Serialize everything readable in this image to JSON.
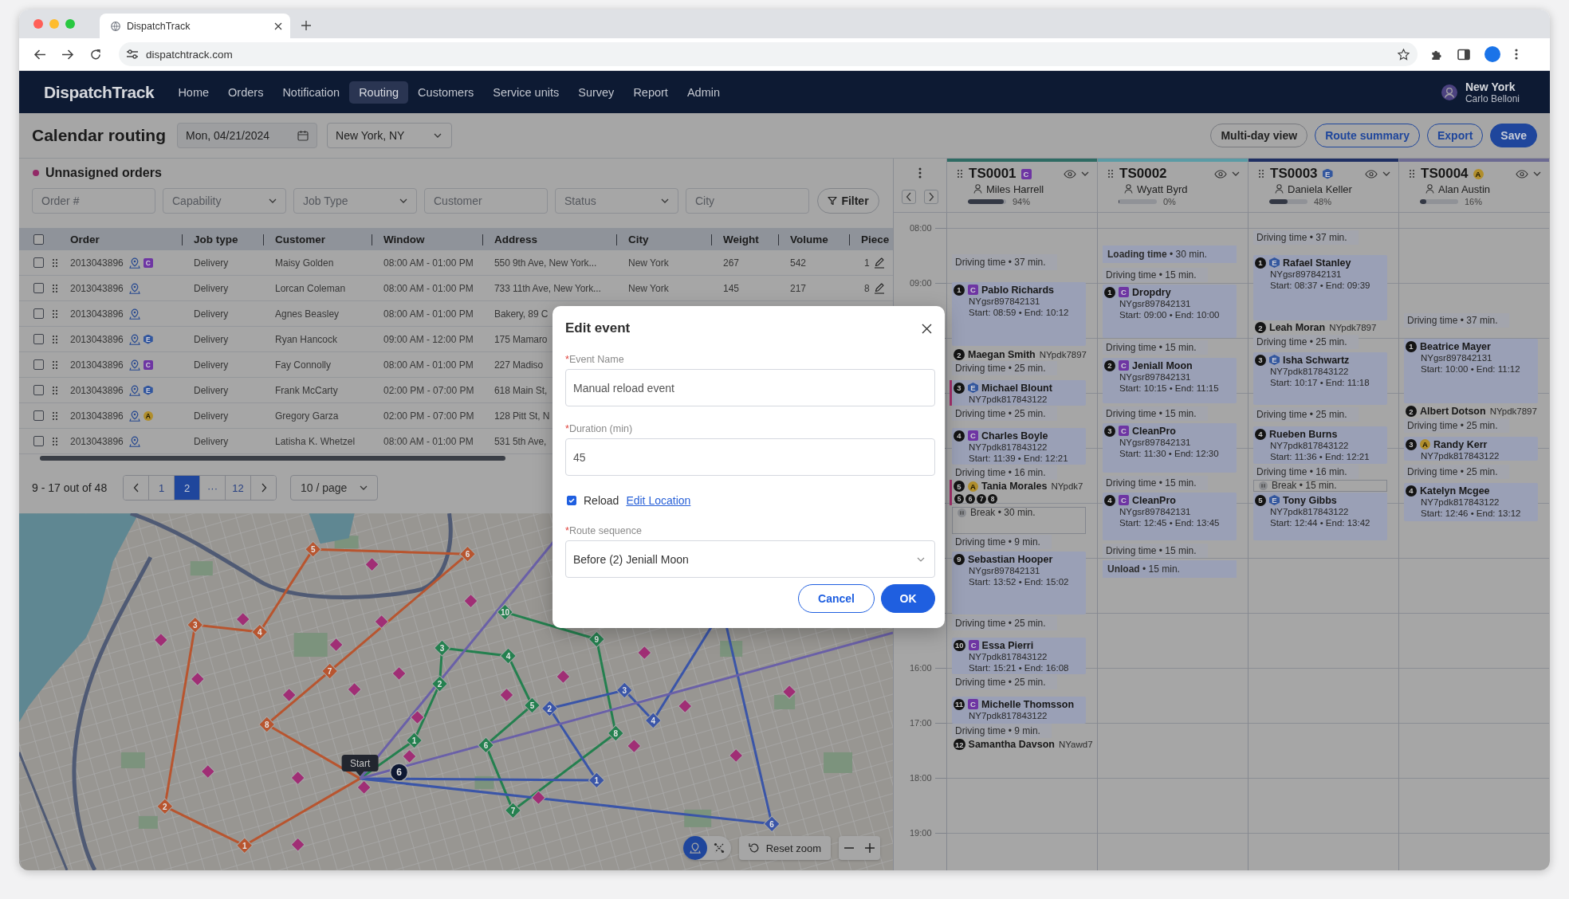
{
  "browser": {
    "tab_title": "DispatchTrack",
    "url": "dispatchtrack.com"
  },
  "nav": {
    "logo": "DispatchTrack",
    "items": [
      {
        "label": "Home",
        "selected": false
      },
      {
        "label": "Orders",
        "selected": false
      },
      {
        "label": "Notification",
        "selected": false
      },
      {
        "label": "Routing",
        "selected": true
      },
      {
        "label": "Customers",
        "selected": false
      },
      {
        "label": "Service units",
        "selected": false
      },
      {
        "label": "Survey",
        "selected": false
      },
      {
        "label": "Report",
        "selected": false
      },
      {
        "label": "Admin",
        "selected": false
      }
    ],
    "user": {
      "location": "New York",
      "name": "Carlo Belloni"
    }
  },
  "header": {
    "title": "Calendar routing",
    "date": "Mon, 04/21/2024",
    "city": "New York, NY",
    "buttons": [
      {
        "label": "Multi-day view",
        "kind": "default"
      },
      {
        "label": "Route summary",
        "kind": "outline"
      },
      {
        "label": "Export",
        "kind": "outline"
      },
      {
        "label": "Save",
        "kind": "primary"
      }
    ]
  },
  "orders": {
    "title": "Unnasigned orders",
    "filters": [
      {
        "kind": "input",
        "placeholder": "Order #"
      },
      {
        "kind": "select",
        "placeholder": "Capability"
      },
      {
        "kind": "select",
        "placeholder": "Job Type"
      },
      {
        "kind": "input",
        "placeholder": "Customer"
      },
      {
        "kind": "select",
        "placeholder": "Status"
      },
      {
        "kind": "input",
        "placeholder": "City"
      }
    ],
    "filter_button": "Filter",
    "select_all": {
      "checked": false
    },
    "columns": [
      "Order",
      "Job type",
      "Customer",
      "Window",
      "Address",
      "City",
      "Weight",
      "Volume",
      "Piece"
    ],
    "rows": [
      {
        "checked": false,
        "order": "2013043896",
        "badge": {
          "kind": "square",
          "text": "C",
          "color": "#6e35a3"
        },
        "job_type": "Delivery",
        "customer": "Maisy Golden",
        "window": "08:00 AM - 01:00 PM",
        "address": "550 9th Ave, New York...",
        "city": "New York",
        "weight": "267",
        "volume": "542",
        "pieces": "1"
      },
      {
        "checked": false,
        "order": "2013043896",
        "job_type": "Delivery",
        "customer": "Lorcan Coleman",
        "window": "08:00 AM - 01:00 PM",
        "address": "733 11th Ave, New York...",
        "city": "New York",
        "weight": "145",
        "volume": "217",
        "pieces": "8"
      },
      {
        "checked": false,
        "order": "2013043896",
        "job_type": "Delivery",
        "customer": "Agnes Beasley",
        "window": "08:00 AM - 01:00 PM",
        "address": "Bakery, 89 C"
      },
      {
        "checked": false,
        "order": "2013043896",
        "badge": {
          "kind": "hexagon",
          "text": "E",
          "color": "#33579e"
        },
        "job_type": "Delivery",
        "customer": "Ryan Hancock",
        "window": "09:00 AM - 12:00 PM",
        "address": "175 Mamaro"
      },
      {
        "checked": false,
        "order": "2013043896",
        "badge": {
          "kind": "square",
          "text": "C",
          "color": "#6e35a3"
        },
        "job_type": "Delivery",
        "customer": "Fay Connolly",
        "window": "08:00 AM - 01:00 PM",
        "address": "227 Madiso"
      },
      {
        "checked": false,
        "order": "2013043896",
        "badge": {
          "kind": "hexagon",
          "text": "E",
          "color": "#33579e"
        },
        "job_type": "Delivery",
        "customer": "Frank McCarty",
        "window": "02:00 PM - 07:00 PM",
        "address": "618 Main St,"
      },
      {
        "checked": false,
        "order": "2013043896",
        "badge": {
          "kind": "circle",
          "text": "A",
          "color": "#b08e2c"
        },
        "job_type": "Delivery",
        "customer": "Gregory Garza",
        "window": "02:00 PM - 07:00 PM",
        "address": "128 Pitt St, N"
      },
      {
        "checked": false,
        "order": "2013043896",
        "job_type": "Delivery",
        "customer": "Latisha K. Whetzel",
        "window": "08:00 AM - 01:00 PM",
        "address": "531 5th Ave,"
      }
    ],
    "pagination": {
      "summary": "9 - 17 out of 48",
      "pages": [
        {
          "label": "1",
          "selected": false
        },
        {
          "label": "2",
          "selected": true
        },
        {
          "label": "···",
          "selected": false
        },
        {
          "label": "12",
          "selected": false
        }
      ],
      "page_size": "10 / page"
    }
  },
  "map": {
    "routes": [
      {
        "color": "#b8552f",
        "stops": [
          "1",
          "2",
          "3",
          "4",
          "5",
          "6",
          "7",
          "8"
        ]
      },
      {
        "color": "#24804f",
        "stops": [
          "1",
          "2",
          "3",
          "4",
          "5",
          "6",
          "7",
          "8",
          "9",
          "10"
        ]
      },
      {
        "color": "#3a55a8",
        "stops": [
          "1",
          "2",
          "3",
          "4",
          "6"
        ]
      },
      {
        "color": "#6a60a8"
      }
    ],
    "start_label": "Start",
    "current_stop": "6",
    "view_modes": [
      {
        "selected": true
      },
      {
        "selected": false
      }
    ],
    "reset_label": "Reset zoom"
  },
  "calendar": {
    "hours": [
      "08:00",
      "09:00",
      "16:00",
      "17:00",
      "18:00",
      "19:00"
    ],
    "routes": [
      {
        "id": "TS0001",
        "color": "#2e6b63",
        "badge": {
          "kind": "square",
          "text": "C",
          "color": "#6e35a3"
        },
        "driver": "Miles Harrell",
        "level": 0.94,
        "percent": "94%",
        "events": [
          {
            "kind": "drive",
            "text": "Driving time • 37 min."
          },
          {
            "kind": "stop",
            "seq": "1",
            "badge": {
              "kind": "square",
              "text": "C",
              "color": "#6e35a3"
            },
            "name": "Pablo Richards",
            "code": "NYgsr897842131",
            "time": "Start: 08:59 • End: 10:12",
            "alert": false
          },
          {
            "kind": "inline",
            "seq": "2",
            "name": "Maegan Smith",
            "code": "NYpdk7897",
            "alert": false
          },
          {
            "kind": "drive",
            "text": "Driving time • 25 min."
          },
          {
            "kind": "stop",
            "seq": "3",
            "badge": {
              "kind": "hexagon",
              "text": "E",
              "color": "#33579e"
            },
            "name": "Michael Blount",
            "code": "NY7pdk817843122",
            "alert": true
          },
          {
            "kind": "drive",
            "text": "Driving time • 25 min."
          },
          {
            "kind": "stop",
            "seq": "4",
            "badge": {
              "kind": "square",
              "text": "C",
              "color": "#6e35a3"
            },
            "name": "Charles Boyle",
            "code": "NY7pdk817843122",
            "time": "Start: 11:39 • End: 12:21",
            "alert": false
          },
          {
            "kind": "drive",
            "text": "Driving time • 16 min."
          },
          {
            "kind": "inline",
            "seq": "5",
            "badge": {
              "kind": "circle",
              "text": "A",
              "color": "#b08e2c"
            },
            "name": "Tania Morales",
            "code": "NYpdk7",
            "alert": true,
            "stacked": [
              "5",
              "6",
              "7",
              "8"
            ]
          },
          {
            "kind": "break",
            "text": "Break • 30 min."
          },
          {
            "kind": "drive",
            "text": "Driving time • 9 min."
          },
          {
            "kind": "stop",
            "seq": "9",
            "name": "Sebastian Hooper",
            "code": "NYgsr897842131",
            "time": "Start: 13:52 • End: 15:02",
            "alert": false
          },
          {
            "kind": "drive",
            "text": "Driving time • 25 min."
          },
          {
            "kind": "stop",
            "seq": "10",
            "badge": {
              "kind": "square",
              "text": "C",
              "color": "#6e35a3"
            },
            "name": "Essa Pierri",
            "code": "NY7pdk817843122",
            "time": "Start: 15:21 • End: 16:08",
            "alert": false
          },
          {
            "kind": "drive",
            "text": "Driving time • 25 min."
          },
          {
            "kind": "stop",
            "seq": "11",
            "badge": {
              "kind": "square",
              "text": "C",
              "color": "#6e35a3"
            },
            "name": "Michelle Thomsson",
            "code": "NY7pdk817843122",
            "alert": false
          },
          {
            "kind": "drive",
            "text": "Driving time • 9 min."
          },
          {
            "kind": "inline",
            "seq": "12",
            "name": "Samantha Davson",
            "code": "NYawd7",
            "alert": false
          }
        ]
      },
      {
        "id": "TS0002",
        "color": "#5a9ba5",
        "driver": "Wyatt Byrd",
        "level": 0,
        "percent": "0%",
        "events": [
          {
            "kind": "loading",
            "text": "**Loading time** • 30 min."
          },
          {
            "kind": "drive",
            "text": "Driving time • 15 min."
          },
          {
            "kind": "stop",
            "seq": "1",
            "badge": {
              "kind": "square",
              "text": "C",
              "color": "#6e35a3"
            },
            "name": "Dropdry",
            "code": "NYgsr897842131",
            "time": "Start: 09:00 • End: 10:00",
            "alert": false
          },
          {
            "kind": "drive",
            "text": "Driving time • 15 min."
          },
          {
            "kind": "stop",
            "seq": "2",
            "badge": {
              "kind": "square",
              "text": "C",
              "color": "#6e35a3"
            },
            "name": "Jeniall Moon",
            "code": "NYgsr897842131",
            "time": "Start: 10:15 • End: 11:15",
            "alert": false
          },
          {
            "kind": "drive",
            "text": "Driving time • 15 min."
          },
          {
            "kind": "stop",
            "seq": "3",
            "badge": {
              "kind": "square",
              "text": "C",
              "color": "#6e35a3"
            },
            "name": "CleanPro",
            "code": "NYgsr897842131",
            "time": "Start: 11:30 • End: 12:30",
            "alert": false
          },
          {
            "kind": "drive",
            "text": "Driving time • 15 min."
          },
          {
            "kind": "stop",
            "seq": "4",
            "badge": {
              "kind": "square",
              "text": "C",
              "color": "#6e35a3"
            },
            "name": "CleanPro",
            "code": "NYgsr897842131",
            "time": "Start: 12:45 • End: 13:45",
            "alert": false
          },
          {
            "kind": "drive",
            "text": "Driving time • 15 min."
          },
          {
            "kind": "unload",
            "text": "**Unload** • 15 min."
          }
        ]
      },
      {
        "id": "TS0003",
        "color": "#1f2f63",
        "badge": {
          "kind": "hexagon",
          "text": "E",
          "color": "#33579e"
        },
        "driver": "Daniela Keller",
        "level": 0.48,
        "percent": "48%",
        "events": [
          {
            "kind": "drive",
            "text": "Driving time • 37 min."
          },
          {
            "kind": "stop",
            "seq": "1",
            "badge": {
              "kind": "hexagon",
              "text": "E",
              "color": "#33579e"
            },
            "name": "Rafael Stanley",
            "code": "NYgsr897842131",
            "time": "Start: 08:37 • End: 09:39",
            "alert": false
          },
          {
            "kind": "inline",
            "seq": "2",
            "name": "Leah Moran",
            "code": "NYpdk7897",
            "alert": false
          },
          {
            "kind": "drive",
            "text": "Driving time • 25 min."
          },
          {
            "kind": "stop",
            "seq": "3",
            "badge": {
              "kind": "hexagon",
              "text": "E",
              "color": "#33579e"
            },
            "name": "Isha Schwartz",
            "code": "NY7pdk817843122",
            "time": "Start: 10:17 • End: 11:18",
            "alert": false
          },
          {
            "kind": "drive",
            "text": "Driving time • 25 min."
          },
          {
            "kind": "stop",
            "seq": "4",
            "name": "Rueben Burns",
            "code": "NY7pdk817843122",
            "time": "Start: 11:36 • End: 12:21",
            "alert": false
          },
          {
            "kind": "drive",
            "text": "Driving time • 16 min."
          },
          {
            "kind": "break",
            "text": "Break • 15 min."
          },
          {
            "kind": "stop",
            "seq": "5",
            "badge": {
              "kind": "hexagon",
              "text": "E",
              "color": "#33579e"
            },
            "name": "Tony Gibbs",
            "code": "NY7pdk817843122",
            "time": "Start: 12:44 • End: 13:42",
            "alert": false
          }
        ]
      },
      {
        "id": "TS0004",
        "color": "#6c6a92",
        "badge": {
          "kind": "circle",
          "text": "A",
          "color": "#b08e2c"
        },
        "driver": "Alan Austin",
        "level": 0.16,
        "percent": "16%",
        "events": [
          {
            "kind": "drive",
            "text": "Driving time • 37 min."
          },
          {
            "kind": "stop",
            "seq": "1",
            "name": "Beatrice Mayer",
            "code": "NYgsr897842131",
            "time": "Start: 10:00 • End: 11:12",
            "alert": false
          },
          {
            "kind": "inline",
            "seq": "2",
            "name": "Albert Dotson",
            "code": "NYpdk7897",
            "alert": false
          },
          {
            "kind": "drive",
            "text": "Driving time • 25 min."
          },
          {
            "kind": "stop",
            "seq": "3",
            "badge": {
              "kind": "circle",
              "text": "A",
              "color": "#b08e2c"
            },
            "name": "Randy Kerr",
            "code": "NY7pdk817843122",
            "alert": false
          },
          {
            "kind": "drive",
            "text": "Driving time • 25 min."
          },
          {
            "kind": "stop",
            "seq": "4",
            "name": "Katelyn Mcgee",
            "code": "NY7pdk817843122",
            "time": "Start: 12:46 • End: 13:12",
            "alert": false
          }
        ]
      }
    ]
  },
  "modal": {
    "title": "Edit event",
    "fields": [
      {
        "required_mark": "*",
        "label": "Event Name",
        "value": "Manual reload event"
      },
      {
        "required_mark": "*",
        "label": "Duration (min)",
        "value": "45"
      }
    ],
    "reload": {
      "checked": true,
      "label": "Reload",
      "link": "Edit Location"
    },
    "sequence": {
      "required_mark": "*",
      "label": "Route sequence",
      "value": "Before (2) Jeniall Moon"
    },
    "buttons": [
      {
        "label": "Cancel",
        "kind": "outline"
      },
      {
        "label": "OK",
        "kind": "primary"
      }
    ]
  }
}
